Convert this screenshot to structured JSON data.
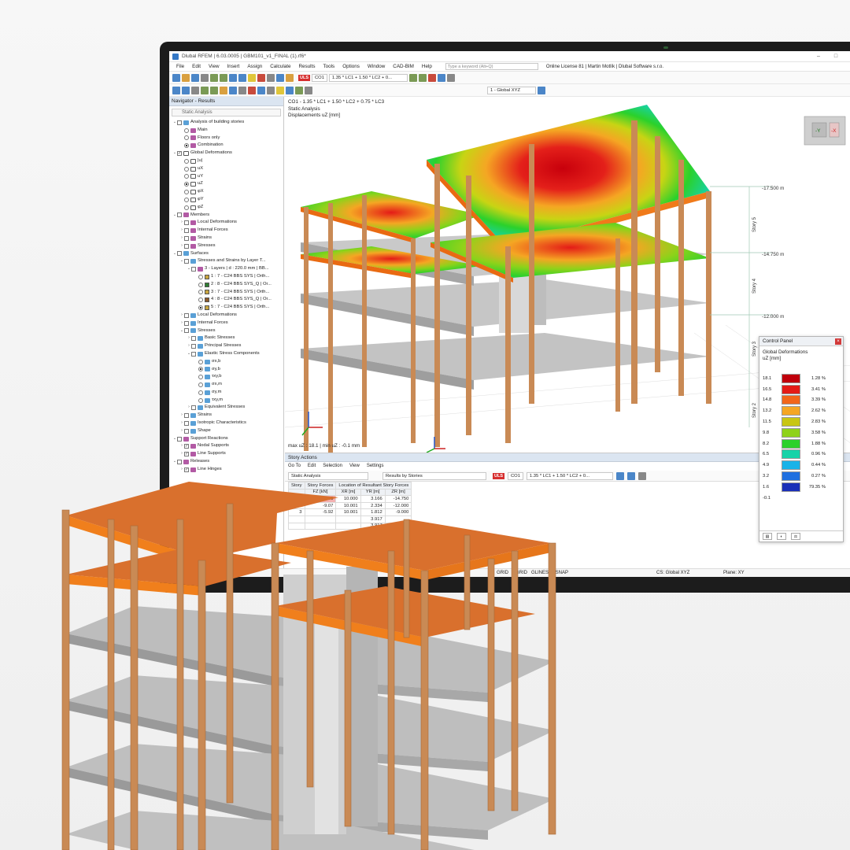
{
  "window": {
    "title": "Dlubal RFEM | 6.03.0005 | GBM101_v1_FINAL (1).rf6*",
    "minimize": "–",
    "maximize": "□",
    "close": "✕"
  },
  "menubar": {
    "items": [
      "File",
      "Edit",
      "View",
      "Insert",
      "Assign",
      "Calculate",
      "Results",
      "Tools",
      "Options",
      "Window",
      "CAD-BIM",
      "Help"
    ],
    "search_placeholder": "Type a keyword (Alt+Q)",
    "license": "Online License 81 | Martin Motlík | Dlubal Software s.r.o."
  },
  "toolbar": {
    "uls": "ULS",
    "co": "CO1",
    "combination": "1.35 * LC1 + 1.50 * LC2 + 0...",
    "coordinate_system": "1 - Global XYZ"
  },
  "navigator": {
    "title": "Navigator - Results",
    "combo": "Static Analysis",
    "items": [
      {
        "label": "Analysis of building stories",
        "level": 0,
        "tw": "⌄",
        "ctl": "cb",
        "ic": "s"
      },
      {
        "label": "Main",
        "level": 1,
        "tw": "",
        "ctl": "rb",
        "ic": "m"
      },
      {
        "label": "Floors only",
        "level": 1,
        "tw": "",
        "ctl": "rb",
        "ic": "m"
      },
      {
        "label": "Combination",
        "level": 1,
        "tw": "",
        "ctl": "rbon",
        "ic": "m"
      },
      {
        "label": "Global Deformations",
        "level": 0,
        "tw": "⌄",
        "ctl": "cbx",
        "ic": "d"
      },
      {
        "label": "|u|",
        "level": 1,
        "tw": "",
        "ctl": "rb",
        "ic": "d"
      },
      {
        "label": "uX",
        "level": 1,
        "tw": "",
        "ctl": "rb",
        "ic": "d"
      },
      {
        "label": "uY",
        "level": 1,
        "tw": "",
        "ctl": "rb",
        "ic": "d"
      },
      {
        "label": "uZ",
        "level": 1,
        "tw": "",
        "ctl": "rbon",
        "ic": "d"
      },
      {
        "label": "φX",
        "level": 1,
        "tw": "",
        "ctl": "rb",
        "ic": "d"
      },
      {
        "label": "φY",
        "level": 1,
        "tw": "",
        "ctl": "rb",
        "ic": "d"
      },
      {
        "label": "φZ",
        "level": 1,
        "tw": "",
        "ctl": "rb",
        "ic": "d"
      },
      {
        "label": "Members",
        "level": 0,
        "tw": "⌄",
        "ctl": "cb",
        "ic": "m"
      },
      {
        "label": "Local Deformations",
        "level": 1,
        "tw": "›",
        "ctl": "cb",
        "ic": "m"
      },
      {
        "label": "Internal Forces",
        "level": 1,
        "tw": "›",
        "ctl": "cb",
        "ic": "m"
      },
      {
        "label": "Strains",
        "level": 1,
        "tw": "›",
        "ctl": "cb",
        "ic": "m"
      },
      {
        "label": "Stresses",
        "level": 1,
        "tw": "›",
        "ctl": "cb",
        "ic": "m"
      },
      {
        "label": "Surfaces",
        "level": 0,
        "tw": "⌄",
        "ctl": "cb",
        "ic": "s"
      },
      {
        "label": "Stresses and Strains by Layer T...",
        "level": 1,
        "tw": "⌄",
        "ctl": "cb",
        "ic": "s"
      },
      {
        "label": "3 - Layers | d : 220.0 mm | BB...",
        "level": 2,
        "tw": "⌄",
        "ctl": "cb",
        "ic": "m"
      },
      {
        "label": "1 : 7 - C24 BBS SYS | Orth...",
        "level": 3,
        "tw": "",
        "ctl": "rb",
        "sw": "#c9a640"
      },
      {
        "label": "2 : 8 - C24 BBS SYS_Q | Or...",
        "level": 3,
        "tw": "",
        "ctl": "rb",
        "sw": "#2e7d32"
      },
      {
        "label": "3 : 7 - C24 BBS SYS | Orth...",
        "level": 3,
        "tw": "",
        "ctl": "rb",
        "sw": "#c9a640"
      },
      {
        "label": "4 : 8 - C24 BBS SYS_Q | Or...",
        "level": 3,
        "tw": "",
        "ctl": "rb",
        "sw": "#8d5a2b"
      },
      {
        "label": "5 : 7 - C24 BBS SYS | Orth...",
        "level": 3,
        "tw": "",
        "ctl": "rbon",
        "sw": "#c9a640"
      },
      {
        "label": "Local Deformations",
        "level": 1,
        "tw": "›",
        "ctl": "cb",
        "ic": "s"
      },
      {
        "label": "Internal Forces",
        "level": 1,
        "tw": "›",
        "ctl": "cb",
        "ic": "s"
      },
      {
        "label": "Stresses",
        "level": 1,
        "tw": "⌄",
        "ctl": "cb",
        "ic": "s"
      },
      {
        "label": "Basic Stresses",
        "level": 2,
        "tw": "›",
        "ctl": "cb",
        "ic": "s"
      },
      {
        "label": "Principal Stresses",
        "level": 2,
        "tw": "›",
        "ctl": "cb",
        "ic": "s"
      },
      {
        "label": "Elastic Stress Components",
        "level": 2,
        "tw": "⌄",
        "ctl": "cb",
        "ic": "s"
      },
      {
        "label": "σx,b",
        "level": 3,
        "tw": "",
        "ctl": "rb",
        "ic": "s"
      },
      {
        "label": "σy,b",
        "level": 3,
        "tw": "",
        "ctl": "rbon",
        "ic": "s"
      },
      {
        "label": "τxy,b",
        "level": 3,
        "tw": "",
        "ctl": "rb",
        "ic": "s"
      },
      {
        "label": "σx,m",
        "level": 3,
        "tw": "",
        "ctl": "rb",
        "ic": "s"
      },
      {
        "label": "σy,m",
        "level": 3,
        "tw": "",
        "ctl": "rb",
        "ic": "s"
      },
      {
        "label": "τxy,m",
        "level": 3,
        "tw": "",
        "ctl": "rb",
        "ic": "s"
      },
      {
        "label": "Equivalent Stresses",
        "level": 2,
        "tw": "›",
        "ctl": "cb",
        "ic": "s"
      },
      {
        "label": "Strains",
        "level": 1,
        "tw": "›",
        "ctl": "cb",
        "ic": "s"
      },
      {
        "label": "Isotropic Characteristics",
        "level": 1,
        "tw": "›",
        "ctl": "cb",
        "ic": "s"
      },
      {
        "label": "Shape",
        "level": 1,
        "tw": "›",
        "ctl": "cb",
        "ic": "s"
      },
      {
        "label": "Support Reactions",
        "level": 0,
        "tw": "⌄",
        "ctl": "cb",
        "ic": "m"
      },
      {
        "label": "Nodal Supports",
        "level": 1,
        "tw": "›",
        "ctl": "cbx",
        "ic": "m"
      },
      {
        "label": "Line Supports",
        "level": 1,
        "tw": "›",
        "ctl": "cbx",
        "ic": "m"
      },
      {
        "label": "Releases",
        "level": 0,
        "tw": "⌄",
        "ctl": "cb",
        "ic": "m"
      },
      {
        "label": "Line Hinges",
        "level": 1,
        "tw": "›",
        "ctl": "cbx",
        "ic": "m"
      }
    ]
  },
  "viewport": {
    "case": "CO1 - 1.35 * LC1 + 1.50 * LC2 + 0.75 * LC3",
    "analysis": "Static Analysis",
    "result": "Displacements uZ [mm]",
    "max_label": "max uZ : 18.1 | min uZ : -0.1 mm",
    "story_levels": [
      "-17.500 m",
      "-14.750 m",
      "-12.000 m"
    ],
    "story_names": [
      "Story 5",
      "Story 4",
      "Story 3",
      "Story 2"
    ],
    "view_cube": [
      "-Y",
      "-X"
    ]
  },
  "control_panel": {
    "title": "Control Panel",
    "close": "×",
    "result_title": "Global Deformations",
    "result_unit": "uZ [mm]",
    "legend": [
      {
        "value": "18.1",
        "color": "#c0000c",
        "pct": "1.28 %"
      },
      {
        "value": "16.5",
        "color": "#e41b17",
        "pct": "3.41 %"
      },
      {
        "value": "14.8",
        "color": "#f2661a",
        "pct": "3.39 %"
      },
      {
        "value": "13.2",
        "color": "#f5a623",
        "pct": "2.62 %"
      },
      {
        "value": "11.5",
        "color": "#c8c614",
        "pct": "2.83 %"
      },
      {
        "value": "9.8",
        "color": "#8ed21a",
        "pct": "3.58 %"
      },
      {
        "value": "8.2",
        "color": "#2bd12b",
        "pct": "1.88 %"
      },
      {
        "value": "6.5",
        "color": "#17d3a8",
        "pct": "0.96 %"
      },
      {
        "value": "4.9",
        "color": "#1ab3e8",
        "pct": "0.44 %"
      },
      {
        "value": "3.2",
        "color": "#1f6fe0",
        "pct": "0.27 %"
      },
      {
        "value": "1.6",
        "color": "#1a2fb8",
        "pct": "79.35 %"
      },
      {
        "value": "-0.1",
        "color": "",
        "pct": ""
      }
    ]
  },
  "story_actions": {
    "title": "Story Actions",
    "menu": [
      "Go To",
      "Edit",
      "Selection",
      "View",
      "Settings"
    ],
    "analysis": "Static Analysis",
    "results_by": "Results by Stories",
    "uls": "ULS",
    "co": "CO1",
    "combination": "1.35 * LC1 + 1.50 * LC2 + 0...",
    "group_forces": "Story Forces",
    "group_location": "Location of Resultant Story Forces",
    "col_story": "Story",
    "col_fz": "FZ [kN]",
    "col_x": "XR [m]",
    "col_y": "YR [m]",
    "col_z": "ZR [m]",
    "rows": [
      {
        "story": "5",
        "fz": "37.09",
        "x": "10.000",
        "y": "3.166",
        "z": "-14.750"
      },
      {
        "story": "4",
        "fz": "-9.07",
        "x": "10.001",
        "y": "2.334",
        "z": "-12.000"
      },
      {
        "story": "3",
        "fz": "-5.92",
        "x": "10.001",
        "y": "1.812",
        "z": "-9.000"
      },
      {
        "story": "",
        "fz": "",
        "x": "",
        "y": "3.917",
        "z": ""
      },
      {
        "story": "",
        "fz": "",
        "x": "",
        "y": "3.917",
        "z": ""
      }
    ]
  },
  "statusbar": {
    "snap": "GRID",
    "grid": "SGRID",
    "glines": "GLINES",
    "osnap": "OSNAP",
    "cs": "CS: Global XYZ",
    "plane": "Plane: XY"
  }
}
